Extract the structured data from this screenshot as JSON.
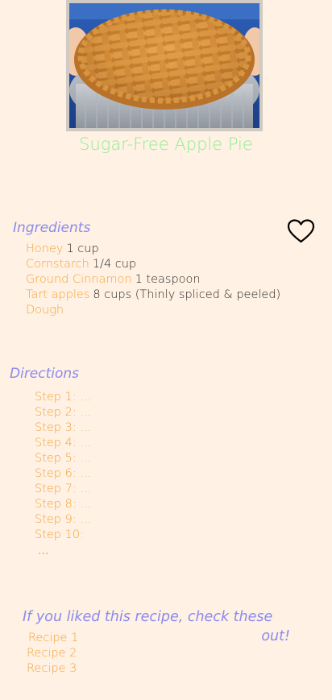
{
  "recipe": {
    "title": "Sugar-Free Apple Pie"
  },
  "colors": {
    "background": "#fff1e3",
    "title": "#90ee90",
    "heading": "#8a8af0",
    "accent": "#f4a23c",
    "text": "#2a2a2a"
  },
  "favorite": {
    "icon": "heart-outline-icon"
  },
  "ingredients": {
    "heading": "Ingredients",
    "items": [
      {
        "name": "Honey",
        "quantity": "1 cup"
      },
      {
        "name": "Cornstarch",
        "quantity": "1/4 cup"
      },
      {
        "name": "Ground Cinnamon",
        "quantity": "1 teaspoon"
      },
      {
        "name": "Tart apples",
        "quantity": "8 cups (Thinly spliced & peeled)"
      },
      {
        "name": "Dough",
        "quantity": ""
      }
    ]
  },
  "directions": {
    "heading": "Directions",
    "steps": [
      "Step 1: ...",
      "Step 2: ...",
      "Step 3: ...",
      "Step 4: ...",
      "Step 5: ...",
      "Step 6: ...",
      "Step 7: ...",
      "Step 8: ...",
      "Step 9: ...",
      "Step 10:"
    ],
    "more": "..."
  },
  "more_recipes": {
    "heading_line1": "If you liked this recipe, check these",
    "heading_line2": "out!",
    "items": [
      "Recipe 1",
      "Recipe 2",
      "Recipe 3"
    ]
  }
}
